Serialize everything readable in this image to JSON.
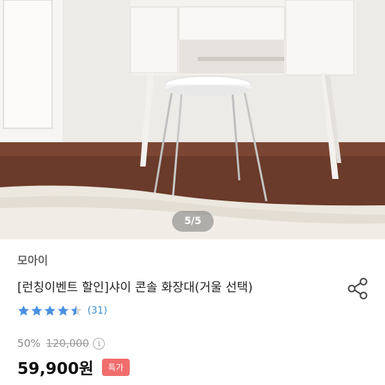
{
  "gallery": {
    "counter": "5/5"
  },
  "product": {
    "brand": "모아이",
    "title": "[런칭이벤트 할인]샤이 콘솔 화장대(거울 선택)",
    "rating": {
      "stars": 4.5,
      "max": 5,
      "reviews": "(31)",
      "color": "#4a90e2"
    },
    "discount": "50%",
    "original_price": "120,000",
    "price": "59,900원",
    "badge": "특가",
    "badge_color": "#f06d6d"
  },
  "icons": {
    "share": "share-icon",
    "info": "info-icon",
    "star": "star-icon"
  }
}
